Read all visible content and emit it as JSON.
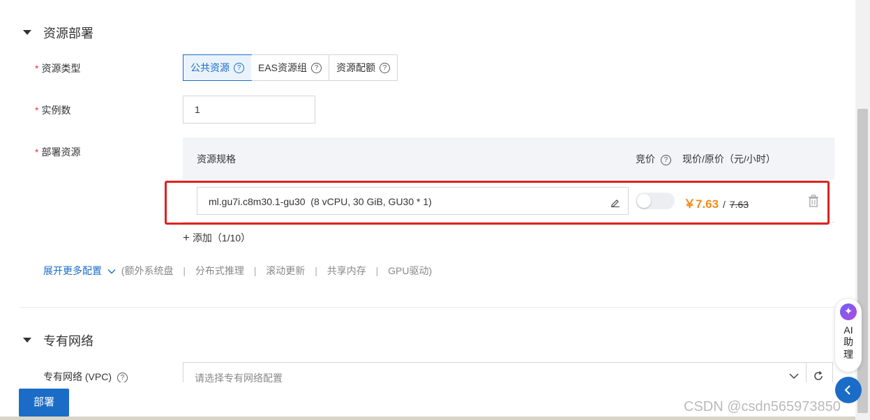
{
  "deploy_section": {
    "title": "资源部署",
    "resource_type": {
      "label": "资源类型",
      "options": [
        "公共资源",
        "EAS资源组",
        "资源配额"
      ],
      "selected": "公共资源"
    },
    "instance_count": {
      "label": "实例数",
      "value": "1"
    },
    "deploy_resource": {
      "label": "部署资源",
      "col_spec": "资源规格",
      "col_bid": "竞价",
      "col_price": "现价/原价（元/小时）",
      "spec_value": "ml.gu7i.c8m30.1-gu30  (8 vCPU, 30 GiB, GU30 * 1)",
      "current_price": "￥7.63",
      "price_sep": "/",
      "original_price": "7.63",
      "add_label": "添加（1/10）"
    },
    "expand": {
      "label": "展开更多配置",
      "open_paren": "(",
      "items": [
        "额外系统盘",
        "分布式推理",
        "滚动更新",
        "共享内存",
        "GPU驱动"
      ],
      "close_paren": ")"
    }
  },
  "vpc_section": {
    "title": "专有网络",
    "vpc_label": "专有网络 (VPC)",
    "vpc_placeholder": "请选择专有网络配置"
  },
  "deploy_button": "部署",
  "ai_assistant": {
    "line1": "AI",
    "line2": "助",
    "line3": "理"
  },
  "watermark": "CSDN @csdn565973850",
  "colors": {
    "accent": "#1a6cc7",
    "price": "#f08c1b",
    "required": "#e23a3a",
    "highlight": "#e02020"
  }
}
